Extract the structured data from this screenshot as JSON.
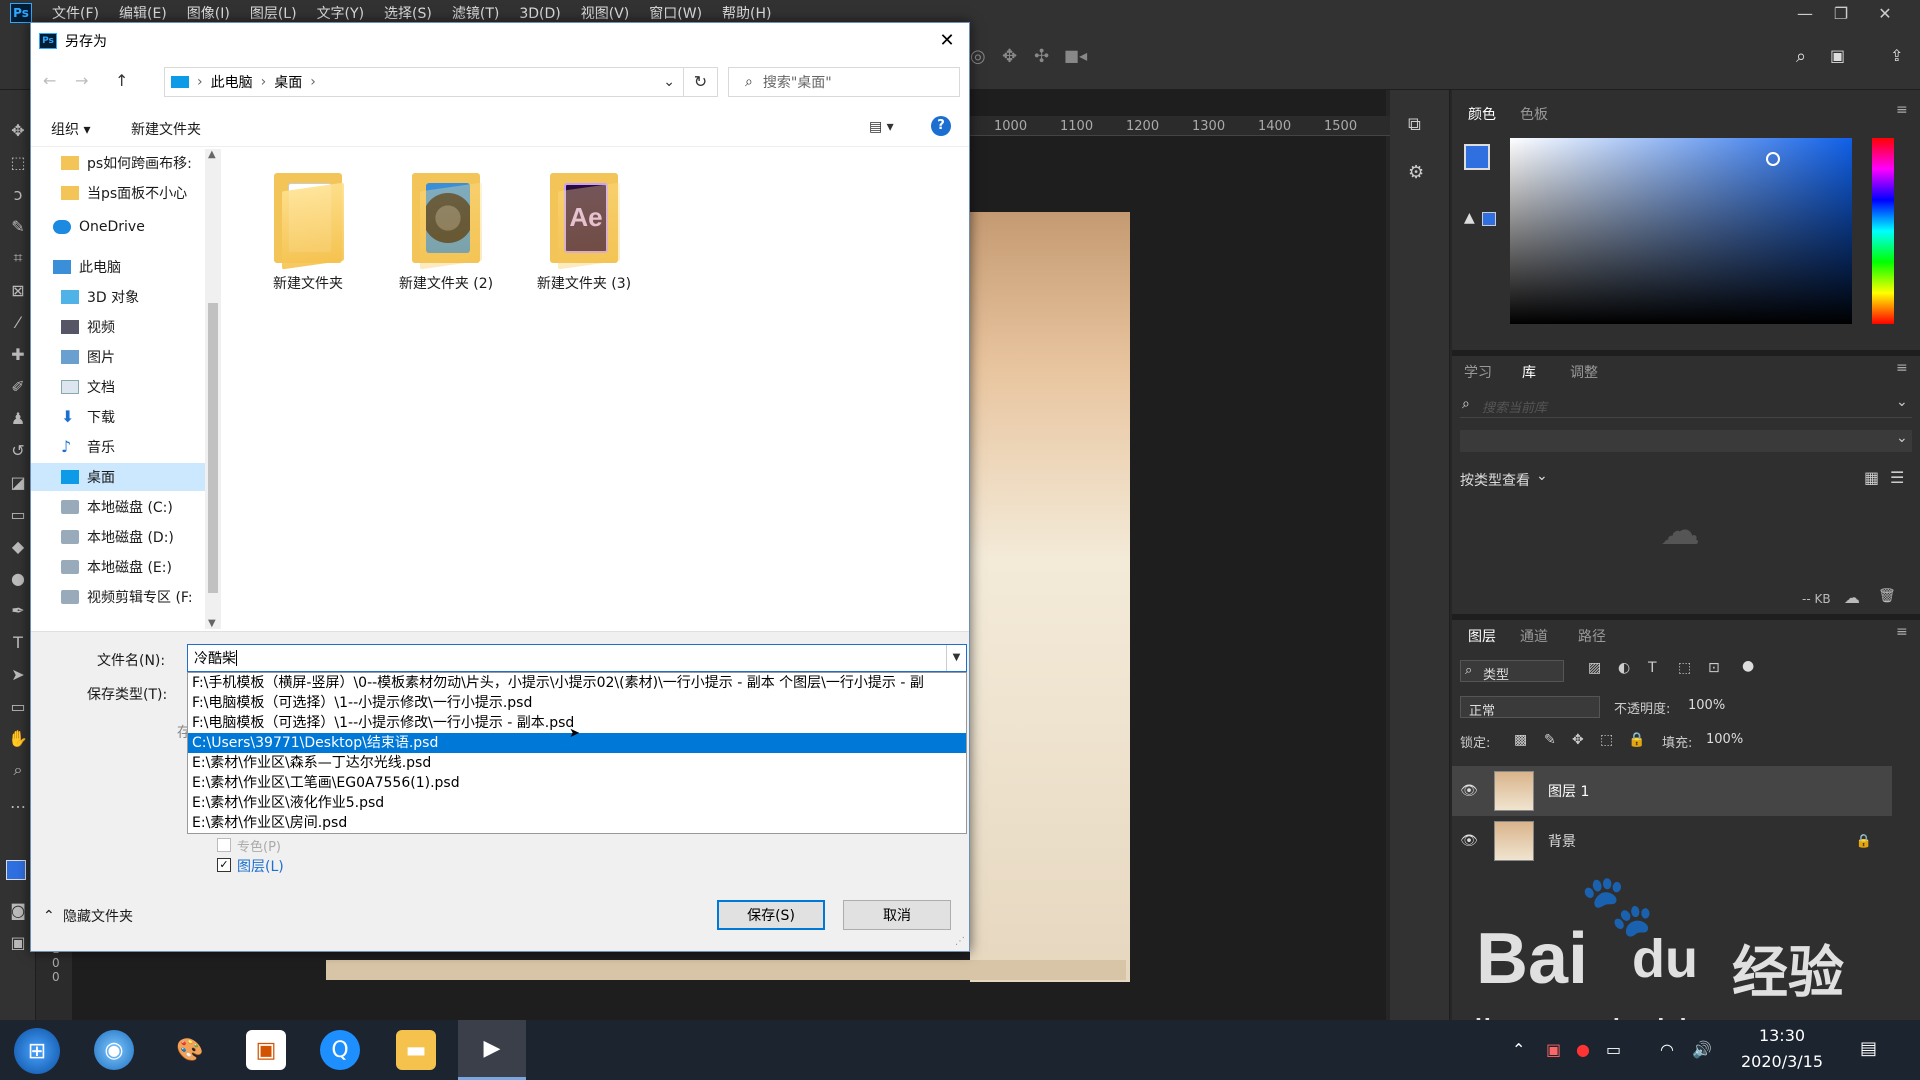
{
  "app": {
    "logo": "Ps",
    "menu": [
      "文件(F)",
      "编辑(E)",
      "图像(I)",
      "图层(L)",
      "文字(Y)",
      "选择(S)",
      "滤镜(T)",
      "3D(D)",
      "视图(V)",
      "窗口(W)",
      "帮助(H)"
    ]
  },
  "ruler": {
    "ticks": [
      "1000",
      "1100",
      "1200",
      "1300",
      "1400",
      "1500"
    ]
  },
  "ruler_v": {
    "ticks": [
      "1",
      "0",
      "0"
    ]
  },
  "panels": {
    "color_tabs": [
      "颜色",
      "色板"
    ],
    "library_tabs": [
      "学习",
      "库",
      "调整"
    ],
    "library_search_placeholder": "搜索当前库",
    "view_by": "按类型查看",
    "kb": "-- KB",
    "layer_tabs": [
      "图层",
      "通道",
      "路径"
    ],
    "filter": "类型",
    "blend_mode": "正常",
    "opacity_label": "不透明度:",
    "opacity_value": "100%",
    "lock_label": "锁定:",
    "fill_label": "填充:",
    "fill_value": "100%",
    "layers": [
      {
        "name": "图层 1",
        "locked": false
      },
      {
        "name": "背景",
        "locked": true
      }
    ]
  },
  "dialog": {
    "title": "另存为",
    "breadcrumb": [
      "此电脑",
      "桌面"
    ],
    "search_placeholder": "搜索\"桌面\"",
    "organize": "组织 ▾",
    "new_folder": "新建文件夹",
    "nav_items": [
      {
        "label": "ps如何跨画布移:",
        "icon": "folder-icon"
      },
      {
        "label": "当ps面板不小心",
        "icon": "folder-icon"
      },
      {
        "label": "OneDrive",
        "icon": "cloud-icon"
      },
      {
        "label": "此电脑",
        "icon": "computer-icon"
      },
      {
        "label": "3D 对象",
        "icon": "cube-icon"
      },
      {
        "label": "视频",
        "icon": "video-icon"
      },
      {
        "label": "图片",
        "icon": "picture-icon"
      },
      {
        "label": "文档",
        "icon": "document-icon"
      },
      {
        "label": "下载",
        "icon": "download-icon"
      },
      {
        "label": "音乐",
        "icon": "music-icon"
      },
      {
        "label": "桌面",
        "icon": "desktop-icon"
      },
      {
        "label": "本地磁盘 (C:)",
        "icon": "drive-icon"
      },
      {
        "label": "本地磁盘 (D:)",
        "icon": "drive-icon"
      },
      {
        "label": "本地磁盘 (E:)",
        "icon": "drive-icon"
      },
      {
        "label": "视频剪辑专区 (F:",
        "icon": "drive-icon"
      }
    ],
    "files": [
      {
        "name": "新建文件夹",
        "overlay": "document-icon"
      },
      {
        "name": "新建文件夹 (2)",
        "overlay": "davinci-icon"
      },
      {
        "name": "新建文件夹 (3)",
        "overlay": "after-effects-icon",
        "overlay_text": "Ae"
      }
    ],
    "filename_label": "文件名(N):",
    "filename_value": "冷酷柴",
    "savetype_label": "保存类型(T):",
    "savetype_partial": "存",
    "suggestions": [
      "F:\\手机模板（横屏-竖屏）\\0--模板素材勿动\\片头，小提示\\小提示02\\(素材)\\一行小提示 - 副本 个图层\\一行小提示 - 副",
      "F:\\电脑模板（可选择）\\1--小提示修改\\一行小提示.psd",
      "F:\\电脑模板（可选择）\\1--小提示修改\\一行小提示 - 副本.psd",
      "C:\\Users\\39771\\Desktop\\结束语.psd",
      "E:\\素材\\作业区\\森系—丁达尔光线.psd",
      "E:\\素材\\作业区\\工笔画\\EG0A7556(1).psd",
      "E:\\素材\\作业区\\液化作业5.psd",
      "E:\\素材\\作业区\\房间.psd"
    ],
    "highlighted_index": 3,
    "option_spot": "专色(P)",
    "option_layers": "图层(L)",
    "hide_folders": "隐藏文件夹",
    "save_button": "保存(S)",
    "cancel_button": "取消"
  },
  "taskbar": {
    "time": "13:30",
    "date": "2020/3/15"
  },
  "watermark": {
    "brand": "Bai",
    "du": "du",
    "jingyan": "经验",
    "url": "jingyan.baidu.com"
  },
  "colors": {
    "ps_bg": "#323232",
    "dialog_accent": "#0078d7",
    "foreground_swatch": "#2f6fe0"
  }
}
